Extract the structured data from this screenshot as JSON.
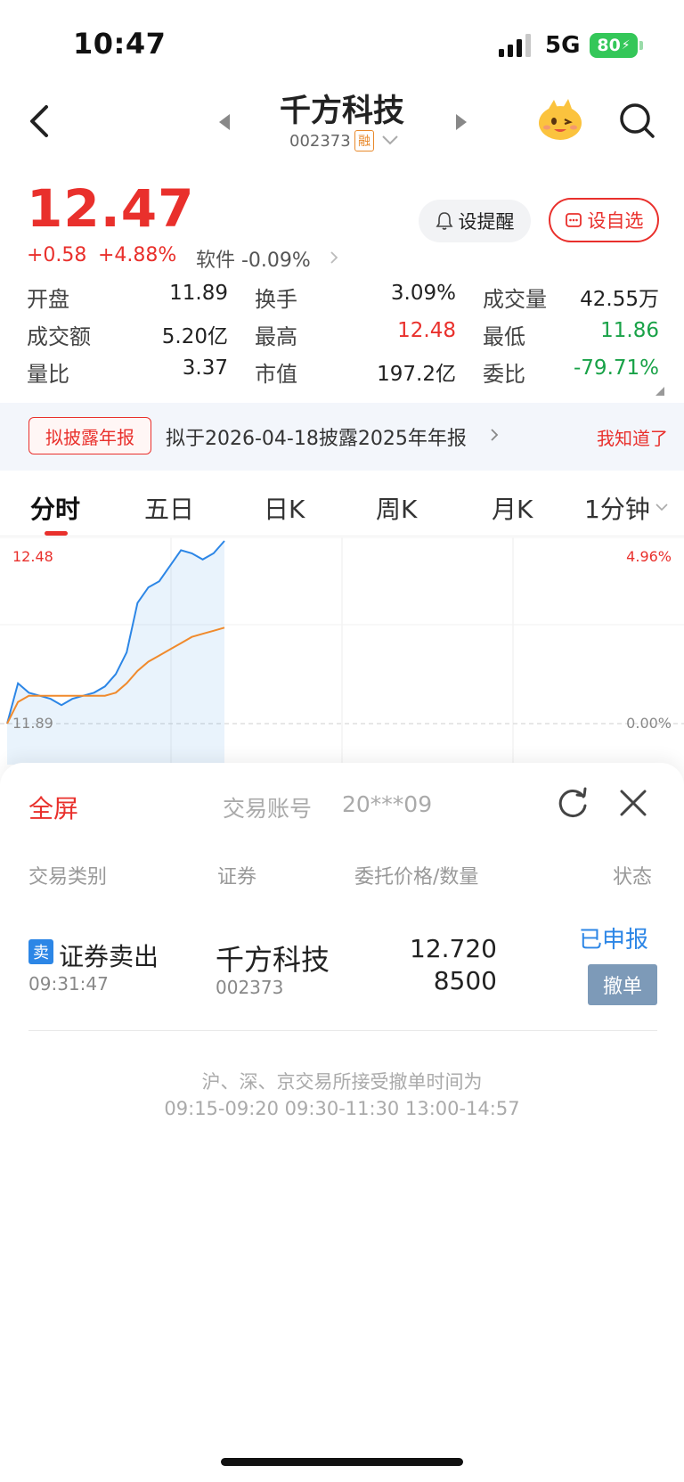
{
  "status_bar": {
    "time": "10:47",
    "network": "5G",
    "battery": "80"
  },
  "nav": {
    "stock_name": "千方科技",
    "stock_code": "002373",
    "margin_badge": "融"
  },
  "quote": {
    "price": "12.47",
    "change": "+0.58",
    "change_pct": "+4.88%",
    "sector": "软件 -0.09%",
    "alert_label": "设提醒",
    "watch_label": "设自选"
  },
  "stats": [
    [
      {
        "label": "开盘",
        "value": "11.89",
        "color": "normal"
      },
      {
        "label": "换手",
        "value": "3.09%",
        "color": "normal"
      },
      {
        "label": "成交量",
        "value": "42.55万",
        "color": "normal"
      }
    ],
    [
      {
        "label": "成交额",
        "value": "5.20亿",
        "color": "normal"
      },
      {
        "label": "最高",
        "value": "12.48",
        "color": "red"
      },
      {
        "label": "最低",
        "value": "11.86",
        "color": "green"
      }
    ],
    [
      {
        "label": "量比",
        "value": "3.37",
        "color": "normal"
      },
      {
        "label": "市值",
        "value": "197.2亿",
        "color": "normal"
      },
      {
        "label": "委比",
        "value": "-79.71%",
        "color": "green"
      }
    ]
  ],
  "banner": {
    "tag": "拟披露年报",
    "text": "拟于2026-04-18披露2025年年报",
    "dismiss": "我知道了"
  },
  "tabs": [
    "分时",
    "五日",
    "日K",
    "周K",
    "月K",
    "1分钟"
  ],
  "chart_data": {
    "type": "line",
    "y_labels_left": [
      "12.48",
      "11.89"
    ],
    "y_labels_right": [
      "4.96%",
      "0.00%"
    ],
    "series": [
      {
        "name": "",
        "color": "#2c86e6",
        "values": [
          11.89,
          12.02,
          11.99,
          11.98,
          11.97,
          11.95,
          11.97,
          11.98,
          11.99,
          12.01,
          12.05,
          12.12,
          12.28,
          12.33,
          12.35,
          12.4,
          12.45,
          12.44,
          12.42,
          12.44,
          12.48
        ]
      },
      {
        "name": "",
        "color": "#f08a2c",
        "values": [
          11.89,
          11.96,
          11.98,
          11.98,
          11.98,
          11.98,
          11.98,
          11.98,
          11.98,
          11.98,
          11.99,
          12.02,
          12.06,
          12.09,
          12.11,
          12.13,
          12.15,
          12.17,
          12.18,
          12.19,
          12.2
        ]
      }
    ],
    "ylim": [
      11.89,
      12.48
    ]
  },
  "sheet": {
    "fullscreen": "全屏",
    "account_label": "交易账号",
    "account_value": "20***09",
    "headers": [
      "交易类别",
      "证券",
      "委托价格/数量",
      "状态"
    ],
    "order": {
      "side_badge": "卖",
      "type": "证券卖出",
      "time": "09:31:47",
      "name": "千方科技",
      "code": "002373",
      "price": "12.720",
      "qty": "8500",
      "status": "已申报",
      "cancel": "撤单"
    },
    "note_line1": "沪、深、京交易所接受撤单时间为",
    "note_line2": "09:15-09:20  09:30-11:30  13:00-14:57"
  }
}
